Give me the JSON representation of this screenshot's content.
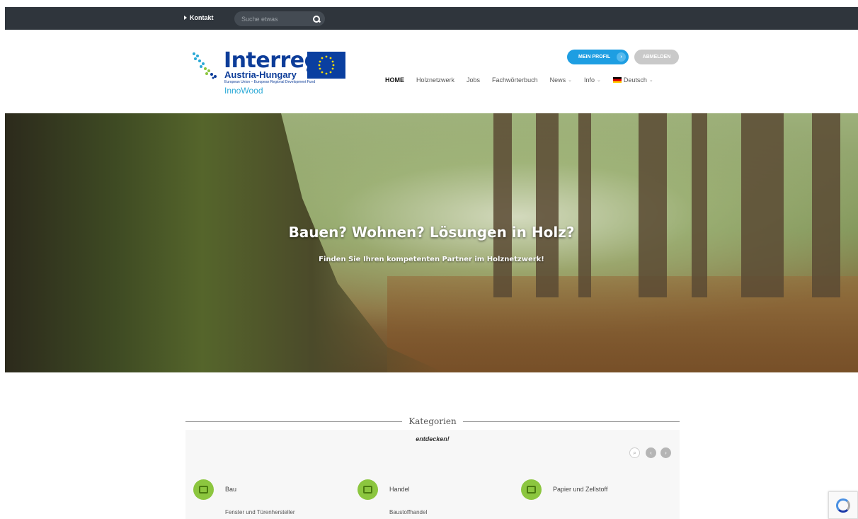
{
  "topbar": {
    "contact_label": "Kontakt",
    "search_placeholder": "Suche etwas"
  },
  "logo": {
    "brand": "Interreg",
    "region": "Austria-Hungary",
    "eu_text": "European Union – European Regional Development Fund",
    "project": "InnoWood"
  },
  "account": {
    "profile_label": "MEIN PROFIL",
    "logout_label": "ABMELDEN"
  },
  "nav": {
    "items": [
      {
        "label": "HOME"
      },
      {
        "label": "Holznetzwerk"
      },
      {
        "label": "Jobs"
      },
      {
        "label": "Fachwörterbuch"
      },
      {
        "label": "News"
      },
      {
        "label": "Info"
      },
      {
        "label": "Deutsch"
      }
    ]
  },
  "hero": {
    "title": "Bauen? Wohnen? Lösungen in Holz?",
    "subtitle": "Finden Sie Ihren kompetenten Partner im Holznetzwerk!"
  },
  "categories": {
    "title": "Kategorien",
    "subtitle": "entdecken!",
    "items": [
      {
        "name": "Bau",
        "sub": "Fenster und Türenhersteller",
        "icon": "building-icon"
      },
      {
        "name": "Handel",
        "sub": "Baustoffhandel",
        "icon": "cart-icon"
      },
      {
        "name": "Papier und Zellstoff",
        "sub": "",
        "icon": "laptop-icon"
      }
    ]
  },
  "colors": {
    "topbar": "#2f353c",
    "accent_blue": "#1e9ee2",
    "category_green": "#8cc63f"
  }
}
